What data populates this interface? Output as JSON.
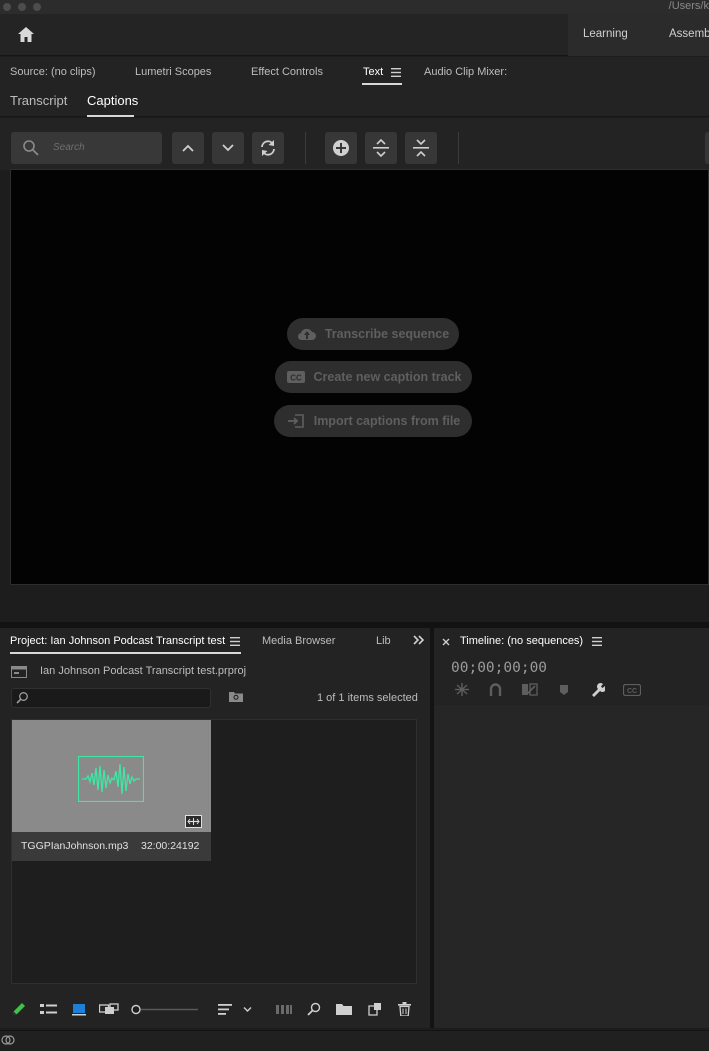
{
  "window": {
    "path_fragment": "/Users/k"
  },
  "header": {
    "workspaces": [
      "Learning",
      "Assemb"
    ]
  },
  "source_panel": {
    "tabs": [
      "Source: (no clips)",
      "Lumetri Scopes",
      "Effect Controls",
      "Text",
      "Audio Clip Mixer:"
    ],
    "active_tab": "Text",
    "subtabs": [
      "Transcript",
      "Captions"
    ],
    "active_subtab": "Captions",
    "search_placeholder": "Search",
    "actions": {
      "transcribe": "Transcribe sequence",
      "create_track": "Create new caption track",
      "import_captions": "Import captions from file"
    }
  },
  "project_panel": {
    "tabs": [
      "Project: Ian Johnson Podcast Transcript test",
      "Media Browser",
      "Lib"
    ],
    "file_name": "Ian Johnson Podcast Transcript test.prproj",
    "selection_status": "1 of 1 items selected",
    "clips": [
      {
        "name": "TGGPIanJohnson.mp3",
        "duration": "32:00:24192"
      }
    ]
  },
  "timeline_panel": {
    "title": "Timeline: (no sequences)",
    "timecode": "00;00;00;00"
  },
  "colors": {
    "accent_waveform": "#3fe6a5",
    "accent_blue": "#1d7fd6",
    "pencil_green": "#3dc24a"
  }
}
